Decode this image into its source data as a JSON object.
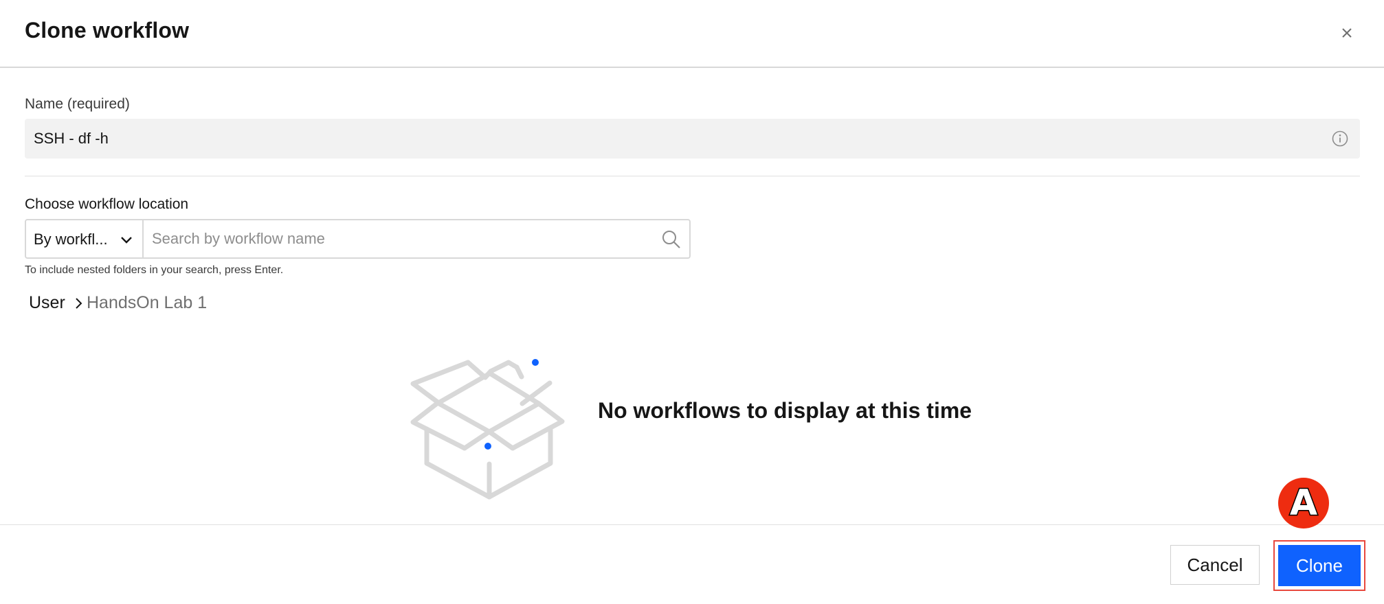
{
  "dialog": {
    "title": "Clone workflow",
    "close_icon": "close-icon"
  },
  "name_field": {
    "label": "Name (required)",
    "value": "SSH - df -h",
    "info_icon": "info-icon"
  },
  "location": {
    "label": "Choose workflow location",
    "dropdown_selected": "By workfl...",
    "search_placeholder": "Search by workflow name",
    "search_icon": "search-icon",
    "hint": "To include nested folders in your search, press Enter."
  },
  "breadcrumb": {
    "root": "User",
    "current": "HandsOn Lab 1"
  },
  "empty_state": {
    "message": "No workflows to display at this time",
    "illustration": "empty-box-illustration"
  },
  "footer": {
    "cancel_label": "Cancel",
    "clone_label": "Clone"
  },
  "annotation": {
    "marker_label": "A",
    "marker_color": "#ee2c10",
    "highlight_color": "#e8473d"
  },
  "colors": {
    "primary": "#0f62fe",
    "field_bg": "#f2f2f2",
    "illustration_gray": "#d8d8d8",
    "illustration_accent": "#0f62fe"
  }
}
